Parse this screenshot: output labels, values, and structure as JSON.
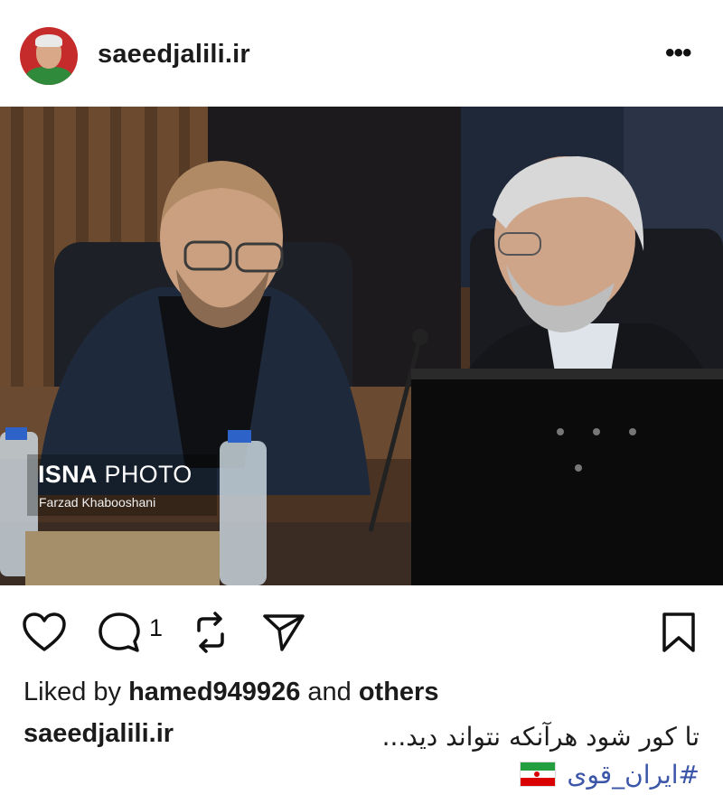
{
  "post": {
    "username": "saeedjalili.ir",
    "more_icon": "ellipsis-icon",
    "more_label": "•••"
  },
  "photo": {
    "watermark_brand_bold": "ISNA",
    "watermark_brand_rest": "PHOTO",
    "watermark_credit": "Farzad Khabooshani"
  },
  "actions": {
    "like_icon": "heart-icon",
    "comment_icon": "comment-icon",
    "comment_count": "1",
    "repost_icon": "repost-icon",
    "share_icon": "send-icon",
    "save_icon": "bookmark-icon"
  },
  "likes": {
    "prefix": "Liked by",
    "user": "hamed949926",
    "middle": "and",
    "others": "others"
  },
  "caption": {
    "username": "saeedjalili.ir",
    "text": "تا کور شود هرآنکه نتواند دید...",
    "hashtag": "#ایران_قوی",
    "flag": "flag-iran-icon"
  },
  "colors": {
    "hashtag": "#3b56a8",
    "avatar_bg": "#c62b2b"
  }
}
